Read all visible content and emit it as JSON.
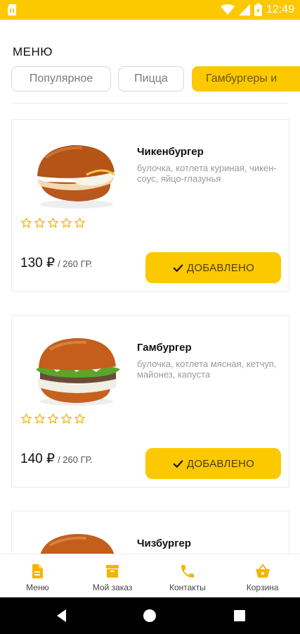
{
  "status_bar": {
    "time": "12:49",
    "icons": [
      "sim-icon",
      "wifi-icon",
      "signal-icon",
      "battery-icon"
    ]
  },
  "header": {
    "title": "МЕНЮ"
  },
  "categories": {
    "items": [
      {
        "label": "Популярное",
        "active": false
      },
      {
        "label": "Пицца",
        "active": false
      },
      {
        "label": "Гамбургеры и",
        "active": true
      }
    ]
  },
  "products": [
    {
      "name": "Чикенбургер",
      "description": "булочка, котлета куриная, чикен-соус, яйцо-глазунья",
      "price": "130 ₽",
      "weight": "/ 260 ГР.",
      "rating_stars": 5,
      "button_label": "ДОБАВЛЕНО"
    },
    {
      "name": "Гамбургер",
      "description": "булочка, котлета мясная, кетчуп, майонез, капуста",
      "price": "140 ₽",
      "weight": "/ 260 ГР.",
      "rating_stars": 5,
      "button_label": "ДОБАВЛЕНО"
    },
    {
      "name": "Чизбургер"
    }
  ],
  "bottom_nav": {
    "items": [
      {
        "label": "Меню",
        "icon": "document-icon"
      },
      {
        "label": "Мой заказ",
        "icon": "order-box-icon"
      },
      {
        "label": "Контакты",
        "icon": "phone-icon"
      },
      {
        "label": "Корзина",
        "icon": "basket-icon"
      }
    ]
  },
  "colors": {
    "accent": "#FCC800",
    "star_outline": "#F5B400",
    "text_muted": "#9a9a9a"
  }
}
